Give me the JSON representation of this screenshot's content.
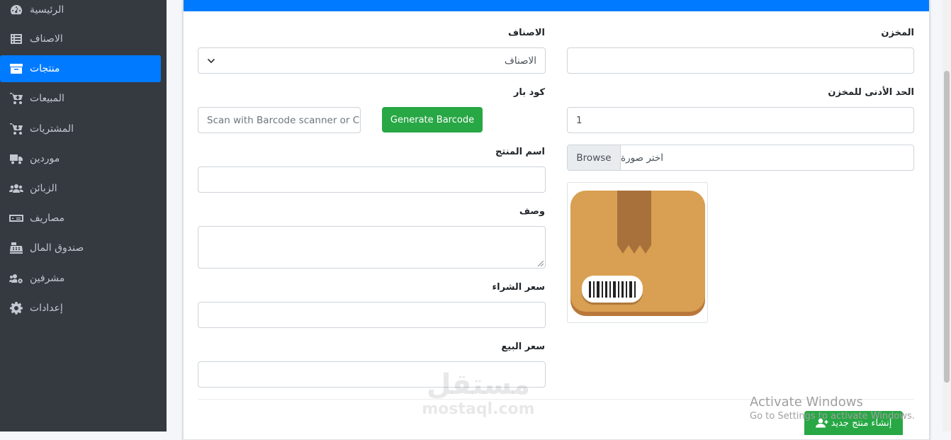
{
  "sidebar": {
    "items": [
      {
        "label": "الرئيسية",
        "icon": "dashboard-icon"
      },
      {
        "label": "الاصناف",
        "icon": "list-icon"
      },
      {
        "label": "منتجات",
        "icon": "archive-icon",
        "active": true
      },
      {
        "label": "المبيعات",
        "icon": "cart-plus-icon"
      },
      {
        "label": "المشتريات",
        "icon": "cart-down-icon"
      },
      {
        "label": "موردين",
        "icon": "truck-icon"
      },
      {
        "label": "الزبائن",
        "icon": "users-icon"
      },
      {
        "label": "مصاريف",
        "icon": "money-bill-icon"
      },
      {
        "label": "صندوق المال",
        "icon": "cash-register-icon"
      },
      {
        "label": "مشرفين",
        "icon": "users-cog-icon"
      },
      {
        "label": "إعدادات",
        "icon": "cog-icon"
      }
    ]
  },
  "form": {
    "warehouse": {
      "label": "المخزن",
      "value": ""
    },
    "min_stock": {
      "label": "الحد الأدنى للمخزن",
      "value": "1"
    },
    "image": {
      "placeholder": "اختر صورة",
      "browse_label": "Browse"
    },
    "category": {
      "label": "الاصناف",
      "selected": "الاصناف"
    },
    "barcode": {
      "label": "كود بار",
      "placeholder": "Scan with Barcode scanner or C",
      "generate_label": "Generate Barcode"
    },
    "product_name": {
      "label": "اسم المنتج",
      "value": ""
    },
    "description": {
      "label": "وصف",
      "value": ""
    },
    "purchase_price": {
      "label": "سعر الشراء",
      "value": ""
    },
    "sale_price": {
      "label": "سعر البيع",
      "value": ""
    },
    "submit_label": "إنشاء منتج جديد"
  },
  "colors": {
    "primary": "#007bff",
    "success": "#28a745",
    "sidebar": "#343a40"
  },
  "watermark": {
    "arabic": "مستقل",
    "latin": "mostaql.com"
  },
  "windows_activation": {
    "title": "Activate Windows",
    "subtitle": "Go to Settings to activate Windows."
  }
}
